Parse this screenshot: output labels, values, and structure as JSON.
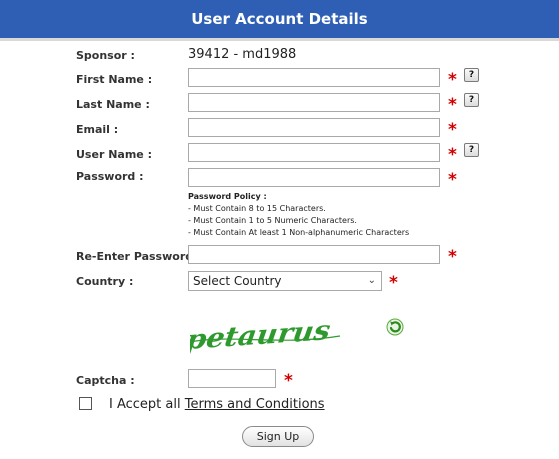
{
  "header": {
    "title": "User Account Details"
  },
  "form": {
    "sponsor_label": "Sponsor :",
    "sponsor_value": "39412 - md1988",
    "first_name_label": "First Name :",
    "last_name_label": "Last Name :",
    "email_label": "Email :",
    "user_name_label": "User Name :",
    "password_label": "Password :",
    "reenter_password_label": "Re-Enter Password :",
    "country_label": "Country :",
    "country_selected": "Select Country",
    "captcha_label": "Captcha :",
    "captcha_text": "petaurus",
    "required_marker": "*",
    "help_marker": "?"
  },
  "password_policy": {
    "title": "Password Policy :",
    "rules": [
      "- Must Contain 8 to 15 Characters.",
      "- Must Contain 1 to 5 Numeric Characters.",
      "- Must Contain At least 1 Non-alphanumeric Characters"
    ]
  },
  "terms": {
    "prefix": "I Accept all ",
    "link": "Terms and Conditions"
  },
  "actions": {
    "signup_label": "Sign Up"
  },
  "colors": {
    "header_bg": "#2e5fb5",
    "required": "#d40000",
    "captcha": "#2e9a2e"
  }
}
